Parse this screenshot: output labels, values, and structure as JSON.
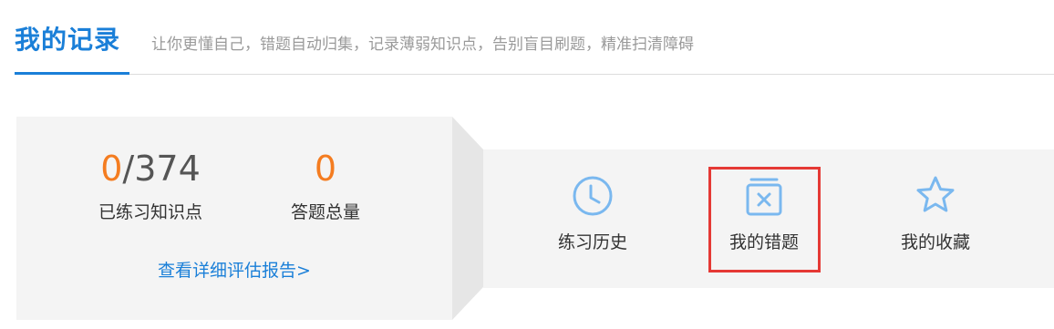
{
  "header": {
    "title": "我的记录",
    "subtitle": "让你更懂自己，错题自动归集，记录薄弱知识点，告别盲目刷题，精准扫清障碍"
  },
  "stats": {
    "practiced": {
      "value_highlight": "0",
      "value_rest": "/374",
      "label": "已练习知识点"
    },
    "answered": {
      "value": "0",
      "label": "答题总量"
    },
    "report_link": "查看详细评估报告>"
  },
  "nav": {
    "items": [
      {
        "label": "练习历史",
        "icon": "clock-icon"
      },
      {
        "label": "我的错题",
        "icon": "wrong-questions-icon",
        "highlighted": true
      },
      {
        "label": "我的收藏",
        "icon": "star-icon"
      }
    ]
  },
  "colors": {
    "accent": "#1a7fd8",
    "number_highlight": "#f47c20",
    "icon": "#7ab8ef",
    "highlight_border": "#e53935"
  }
}
